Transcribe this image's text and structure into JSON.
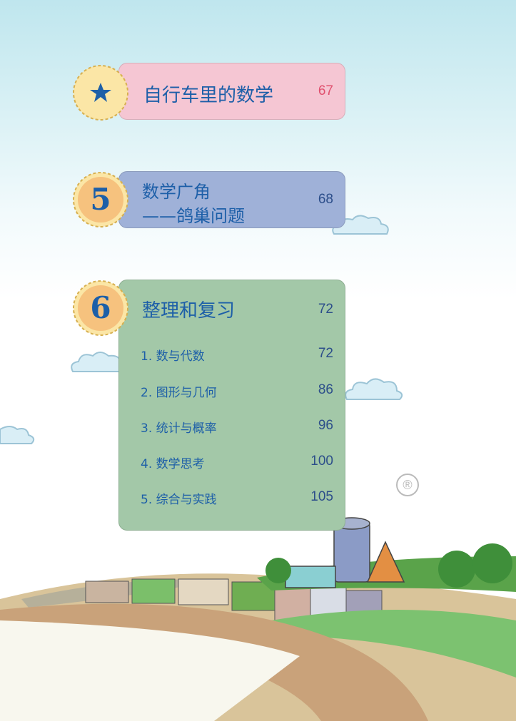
{
  "sections": [
    {
      "badge": {
        "icon": "star-icon"
      },
      "title": "自行车里的数学",
      "page": "67"
    },
    {
      "badge": {
        "number": "5"
      },
      "title_line1": "数学广角",
      "title_line2": "——鸽巢问题",
      "page": "68"
    },
    {
      "badge": {
        "number": "6"
      },
      "title": "整理和复习",
      "page": "72",
      "items": [
        {
          "label": "1. 数与代数",
          "page": "72"
        },
        {
          "label": "2. 图形与几何",
          "page": "86"
        },
        {
          "label": "3. 统计与概率",
          "page": "96"
        },
        {
          "label": "4. 数学思考",
          "page": "100"
        },
        {
          "label": "5. 综合与实践",
          "page": "105"
        }
      ]
    }
  ],
  "watermark": {
    "registered_mark": "®"
  },
  "colors": {
    "box_pink": "#f5c6d3",
    "box_blue": "#9fb1d8",
    "box_green": "#a3c8a8",
    "title_blue": "#1d5fa8",
    "badge_fill": "#fbe6a6",
    "page_red": "#e0506e"
  }
}
